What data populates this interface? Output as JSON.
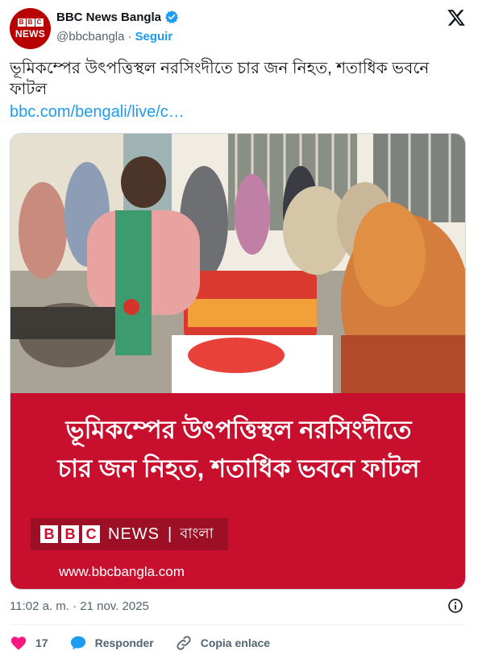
{
  "account": {
    "name": "BBC News Bangla",
    "handle": "@bbcbangla",
    "separator": "·",
    "follow_label": "Seguir",
    "avatar_blocks": [
      "B",
      "B",
      "C"
    ],
    "avatar_text": "NEWS"
  },
  "tweet": {
    "text": "ভূমিকম্পের উৎপত্তিস্থল নরসিংদীতে চার জন নিহত, শতাধিক ভবনে ফাটল",
    "link": "bbc.com/bengali/live/c…"
  },
  "media": {
    "headline_line1": "ভূমিকম্পের উৎপত্তিস্থল নরসিংদীতে",
    "headline_line2": "চার জন নিহত, শতাধিক ভবনে ফাটল",
    "brand_blocks": [
      "B",
      "B",
      "C"
    ],
    "brand_news": "NEWS",
    "brand_sep": "|",
    "brand_bangla": "বাংলা",
    "site_url": "www.bbcbangla.com",
    "panel_color": "#c8102e"
  },
  "timestamp": "11:02 a. m. · 21 nov. 2025",
  "actions": {
    "like_count": "17",
    "reply_label": "Responder",
    "copy_label": "Copia enlace"
  },
  "colors": {
    "accent": "#1d9bf0",
    "like": "#f91880",
    "bbc_red": "#b80000"
  },
  "icons": [
    "verified-icon",
    "x-logo-icon",
    "info-icon",
    "heart-icon",
    "reply-icon",
    "link-icon"
  ]
}
